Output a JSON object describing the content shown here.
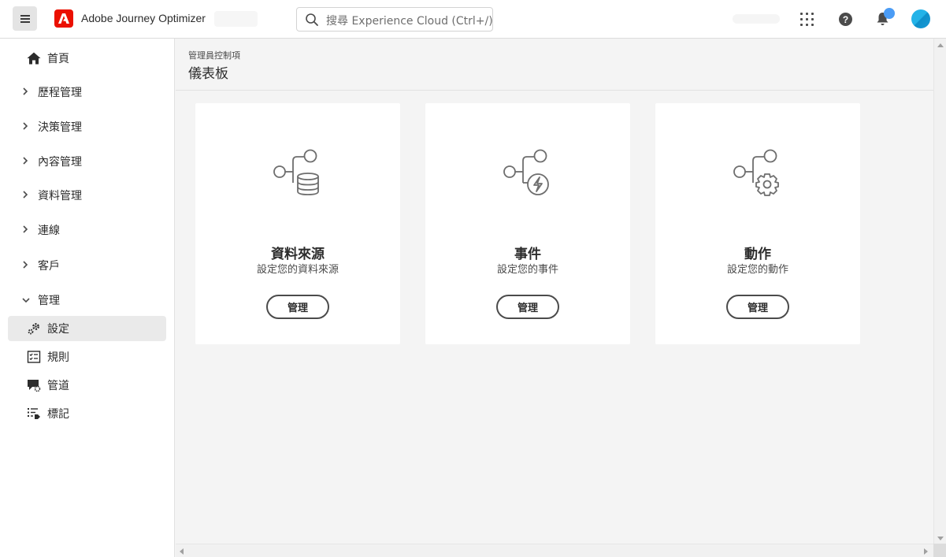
{
  "topbar": {
    "app_title": "Adobe Journey Optimizer",
    "search_placeholder": "搜尋 Experience Cloud (Ctrl+/)",
    "brand_color": "#eb1000"
  },
  "sidebar": {
    "home_label": "首頁",
    "sections": [
      {
        "label": "歷程管理",
        "expanded": false
      },
      {
        "label": "決策管理",
        "expanded": false
      },
      {
        "label": "內容管理",
        "expanded": false
      },
      {
        "label": "資料管理",
        "expanded": false
      },
      {
        "label": "連線",
        "expanded": false
      },
      {
        "label": "客戶",
        "expanded": false
      },
      {
        "label": "管理",
        "expanded": true
      }
    ],
    "admin_items": [
      {
        "label": "設定",
        "icon": "gears-icon",
        "selected": true
      },
      {
        "label": "規則",
        "icon": "checklist-icon",
        "selected": false
      },
      {
        "label": "管道",
        "icon": "channel-icon",
        "selected": false
      },
      {
        "label": "標記",
        "icon": "tag-list-icon",
        "selected": false
      }
    ]
  },
  "main": {
    "breadcrumb": "管理員控制項",
    "page_title": "儀表板",
    "cards": [
      {
        "title": "資料來源",
        "description": "設定您的資料來源",
        "button_label": "管理",
        "icon": "datasource-icon"
      },
      {
        "title": "事件",
        "description": "設定您的事件",
        "button_label": "管理",
        "icon": "event-icon"
      },
      {
        "title": "動作",
        "description": "設定您的動作",
        "button_label": "管理",
        "icon": "action-icon"
      }
    ]
  }
}
